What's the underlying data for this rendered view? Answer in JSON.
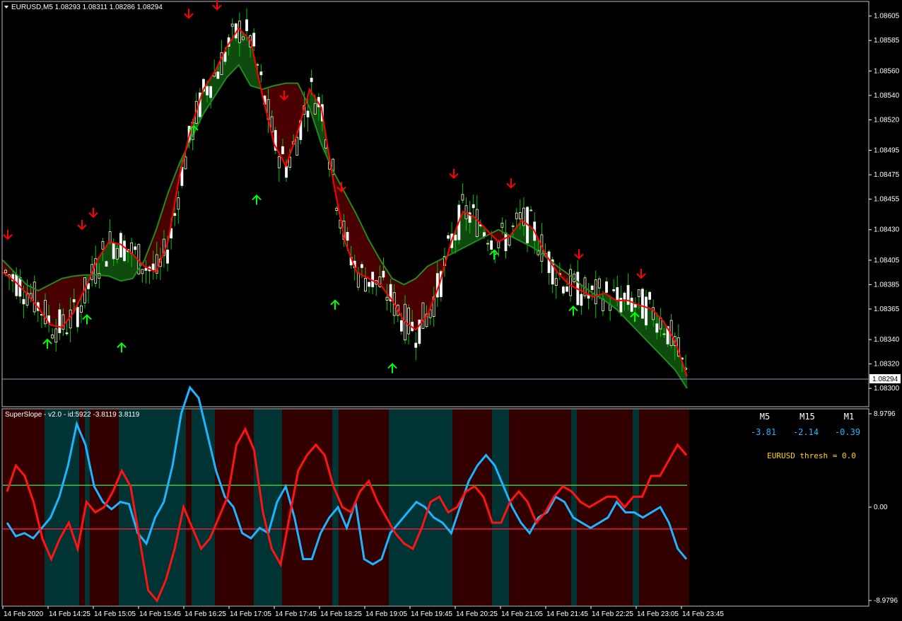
{
  "header": {
    "symbol_line": "EURUSD,M5  1.08293 1.08311 1.08286 1.08294"
  },
  "main_chart": {
    "price_axis_labels": [
      "1.08605",
      "1.08585",
      "1.08560",
      "1.08540",
      "1.08520",
      "1.08495",
      "1.08475",
      "1.08455",
      "1.08430",
      "1.08405",
      "1.08385",
      "1.08365",
      "1.08340",
      "1.08320",
      "1.08300"
    ],
    "current_price": "1.08294",
    "colors": {
      "bull_candle": "#ffffcc",
      "bear_candle": "#ffffff",
      "wick": "#00c800",
      "fast_ma": "#ff0000",
      "slow_ma": "#1e8c1e",
      "fill_up": "#0f4a0f",
      "fill_down": "#4a0000",
      "arrow_up": "#00ff00",
      "arrow_down": "#ff0000"
    },
    "chart_data": {
      "type": "candlestick",
      "symbol": "EURUSD",
      "timeframe": "M5",
      "ylim": [
        1.08285,
        1.08617
      ],
      "last": {
        "open": 1.08293,
        "high": 1.08311,
        "low": 1.08286,
        "close": 1.08294
      },
      "fast_ma": [
        1.08395,
        1.08388,
        1.08378,
        1.08366,
        1.08352,
        1.0835,
        1.08362,
        1.08382,
        1.08405,
        1.0842,
        1.08418,
        1.0841,
        1.084,
        1.08395,
        1.0842,
        1.08475,
        1.08515,
        1.08545,
        1.0856,
        1.0858,
        1.08595,
        1.08585,
        1.0854,
        1.085,
        1.08482,
        1.0851,
        1.08545,
        1.0853,
        1.0847,
        1.0842,
        1.08395,
        1.0839,
        1.08385,
        1.08372,
        1.08355,
        1.08348,
        1.0836,
        1.08385,
        1.0842,
        1.08445,
        1.0844,
        1.0843,
        1.0842,
        1.08425,
        1.08438,
        1.0843,
        1.0841,
        1.08395,
        1.08385,
        1.0838,
        1.08375,
        1.08378,
        1.08372,
        1.08372,
        1.08368,
        1.08365,
        1.08355,
        1.08338,
        1.0831
      ],
      "slow_ma": [
        1.08405,
        1.08395,
        1.08385,
        1.0838,
        1.08385,
        1.0839,
        1.08392,
        1.08393,
        1.08393,
        1.08392,
        1.08388,
        1.0839,
        1.08405,
        1.0843,
        1.0846,
        1.08485,
        1.08505,
        1.08525,
        1.0854,
        1.08555,
        1.08565,
        1.08548,
        1.08545,
        1.08548,
        1.0855,
        1.0855,
        1.0853,
        1.085,
        1.08478,
        1.0846,
        1.08442,
        1.08422,
        1.08405,
        1.0839,
        1.08385,
        1.0839,
        1.084,
        1.08405,
        1.0841,
        1.08415,
        1.0842,
        1.08425,
        1.0843,
        1.08425,
        1.0842,
        1.08415,
        1.08408,
        1.084,
        1.08393,
        1.08385,
        1.08378,
        1.08372,
        1.08365,
        1.08355,
        1.08345,
        1.08335,
        1.08325,
        1.08315,
        1.083
      ],
      "arrows_up": [
        [
          67,
          1.0834
        ],
        [
          123,
          1.0836
        ],
        [
          172,
          1.08337
        ],
        [
          274,
          1.08515
        ],
        [
          363,
          1.08458
        ],
        [
          474,
          1.08372
        ],
        [
          555,
          1.0832
        ],
        [
          699,
          1.08413
        ],
        [
          811,
          1.08367
        ],
        [
          898,
          1.08362
        ]
      ],
      "arrows_down": [
        [
          11,
          1.0843
        ],
        [
          116,
          1.08438
        ],
        [
          132,
          1.08448
        ],
        [
          267,
          1.08611
        ],
        [
          307,
          1.08618
        ],
        [
          402,
          1.08544
        ],
        [
          483,
          1.08469
        ],
        [
          642,
          1.0848
        ],
        [
          723,
          1.08472
        ],
        [
          819,
          1.08414
        ],
        [
          907,
          1.08398
        ]
      ]
    }
  },
  "indicator": {
    "title": "SuperSlope - v2.0 - id:5922 -3.8119 3.8119",
    "axis_top": "8.9796",
    "axis_mid": "0.00",
    "axis_bottom": "-8.9796",
    "table": {
      "headers": [
        "M5",
        "M15",
        "M1"
      ],
      "values": [
        "-3.81",
        "-2.14",
        "-0.39"
      ]
    },
    "thresh_label": "EURUSD thresh = 0.0",
    "colors": {
      "blue_line": "#1eb4ff",
      "red_line": "#ff1414",
      "upper_level": "#3cc83c",
      "lower_level": "#e61e3c",
      "bg_red": "#330000",
      "bg_teal": "#003333"
    },
    "chart_data": {
      "type": "line",
      "ylim": [
        -8.9796,
        8.9796
      ],
      "series": [
        {
          "values": [
            -1.5,
            -2.8,
            -2.5,
            -3.0,
            -2.0,
            -1.0,
            1.0,
            4.0,
            8.0,
            6.0,
            2.0,
            0.5,
            -0.2,
            0.5,
            0.3,
            -2.5,
            -3.5,
            -1.0,
            0.5,
            4.0,
            9.0,
            11.5,
            10.5,
            7.0,
            3.5,
            1.0,
            0.0,
            -2.5,
            -3.0,
            -2.0,
            -2.5,
            0.5,
            2.0,
            -1.0,
            -5.0,
            -5.0,
            -2.5,
            -1.0,
            0.0,
            -2.0,
            0.5,
            -5.0,
            -5.5,
            -5.0,
            -2.5,
            -1.5,
            -0.5,
            0.5,
            0.0,
            -1.0,
            -1.5,
            -2.5,
            0.0,
            2.5,
            4.0,
            5.0,
            4.0,
            2.0,
            0.0,
            -1.5,
            -2.5,
            -1.0,
            -0.5,
            1.0,
            0.5,
            -1.0,
            -1.5,
            -2.0,
            -1.5,
            -1.0,
            0.5,
            -0.5,
            -0.5,
            -1.0,
            -0.5,
            0.0,
            -1.5,
            -4.0,
            -5.0
          ]
        },
        {
          "values": [
            1.5,
            4.0,
            3.0,
            0.5,
            -3.0,
            -5.0,
            -3.0,
            -1.5,
            -4.0,
            0.5,
            -0.5,
            0.0,
            1.5,
            3.5,
            2.0,
            -3.0,
            -8.0,
            -9.0,
            -7.0,
            -4.0,
            0.0,
            -2.0,
            -4.0,
            -3.0,
            -1.0,
            1.0,
            6.0,
            7.5,
            5.5,
            -0.5,
            -4.0,
            -5.5,
            -1.0,
            3.5,
            5.0,
            6.0,
            5.0,
            2.0,
            0.0,
            -0.5,
            1.5,
            2.5,
            0.5,
            -1.0,
            -2.5,
            -3.5,
            -4.0,
            -2.0,
            0.5,
            1.0,
            -0.5,
            0.0,
            1.5,
            2.0,
            1.0,
            -1.5,
            -1.5,
            0.5,
            1.5,
            0.5,
            -1.5,
            -0.5,
            1.0,
            2.0,
            1.5,
            0.5,
            0.0,
            0.5,
            1.0,
            1.0,
            0.0,
            1.0,
            1.0,
            3.0,
            3.0,
            4.5,
            6.0,
            5.0
          ]
        }
      ],
      "levels": [
        2.1,
        -2.1
      ],
      "background_segments": [
        "red",
        "teal",
        "red",
        "teal",
        "red",
        "teal",
        "red",
        "teal",
        "red",
        "teal",
        "red",
        "teal",
        "red",
        "teal",
        "red",
        "teal",
        "red",
        "teal",
        "red"
      ]
    }
  },
  "time_axis": [
    "14 Feb 2020",
    "14 Feb 14:25",
    "14 Feb 15:05",
    "14 Feb 15:45",
    "14 Feb 16:25",
    "14 Feb 17:05",
    "14 Feb 17:45",
    "14 Feb 18:25",
    "14 Feb 19:05",
    "14 Feb 19:45",
    "14 Feb 20:25",
    "14 Feb 21:05",
    "14 Feb 21:45",
    "14 Feb 22:25",
    "14 Feb 23:05",
    "14 Feb 23:45"
  ]
}
